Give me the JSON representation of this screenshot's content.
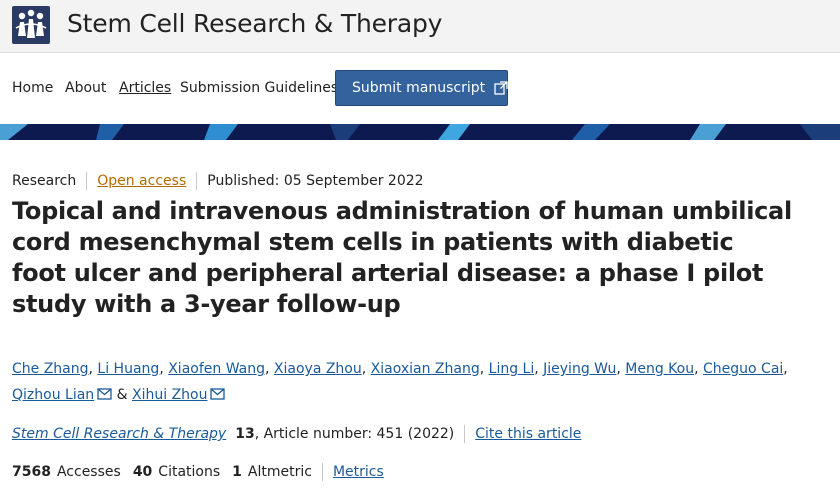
{
  "header": {
    "journal_title": "Stem Cell Research & Therapy",
    "logo_icon": "journal-logo-icon"
  },
  "nav": {
    "items": [
      "Home",
      "About",
      "Articles",
      "Submission Guidelines"
    ],
    "active": "Articles",
    "submit_label": "Submit manuscript",
    "submit_icon": "external-link-icon"
  },
  "article": {
    "type": "Research",
    "access": "Open access",
    "published": "Published: 05 September 2022",
    "title": "Topical and intravenous administration of human umbilical cord mesenchymal stem cells in patients with diabetic foot ulcer and peripheral arterial disease: a phase I pilot study with a 3-year follow-up",
    "authors": [
      "Che Zhang",
      "Li Huang",
      "Xiaofen Wang",
      "Xiaoya Zhou",
      "Xiaoxian Zhang",
      "Ling Li",
      "Jieying Wu",
      "Meng Kou",
      "Cheguo Cai",
      "Qizhou Lian",
      "Xihui Zhou"
    ],
    "author_separator": ",",
    "last_separator": "&",
    "journal": "Stem Cell Research & Therapy",
    "volume": "13",
    "article_number": ", Article number: 451 (2022)",
    "cite_label": "Cite this article"
  },
  "metrics": {
    "accesses_value": "7568",
    "accesses_label": "Accesses",
    "citations_value": "40",
    "citations_label": "Citations",
    "altmetric_value": "1",
    "altmetric_label": "Altmetric",
    "metrics_link": "Metrics"
  },
  "colors": {
    "link": "#1a5a9a",
    "open_access": "#b36b00",
    "button": "#33629d",
    "banner": "#0d1a4f"
  }
}
